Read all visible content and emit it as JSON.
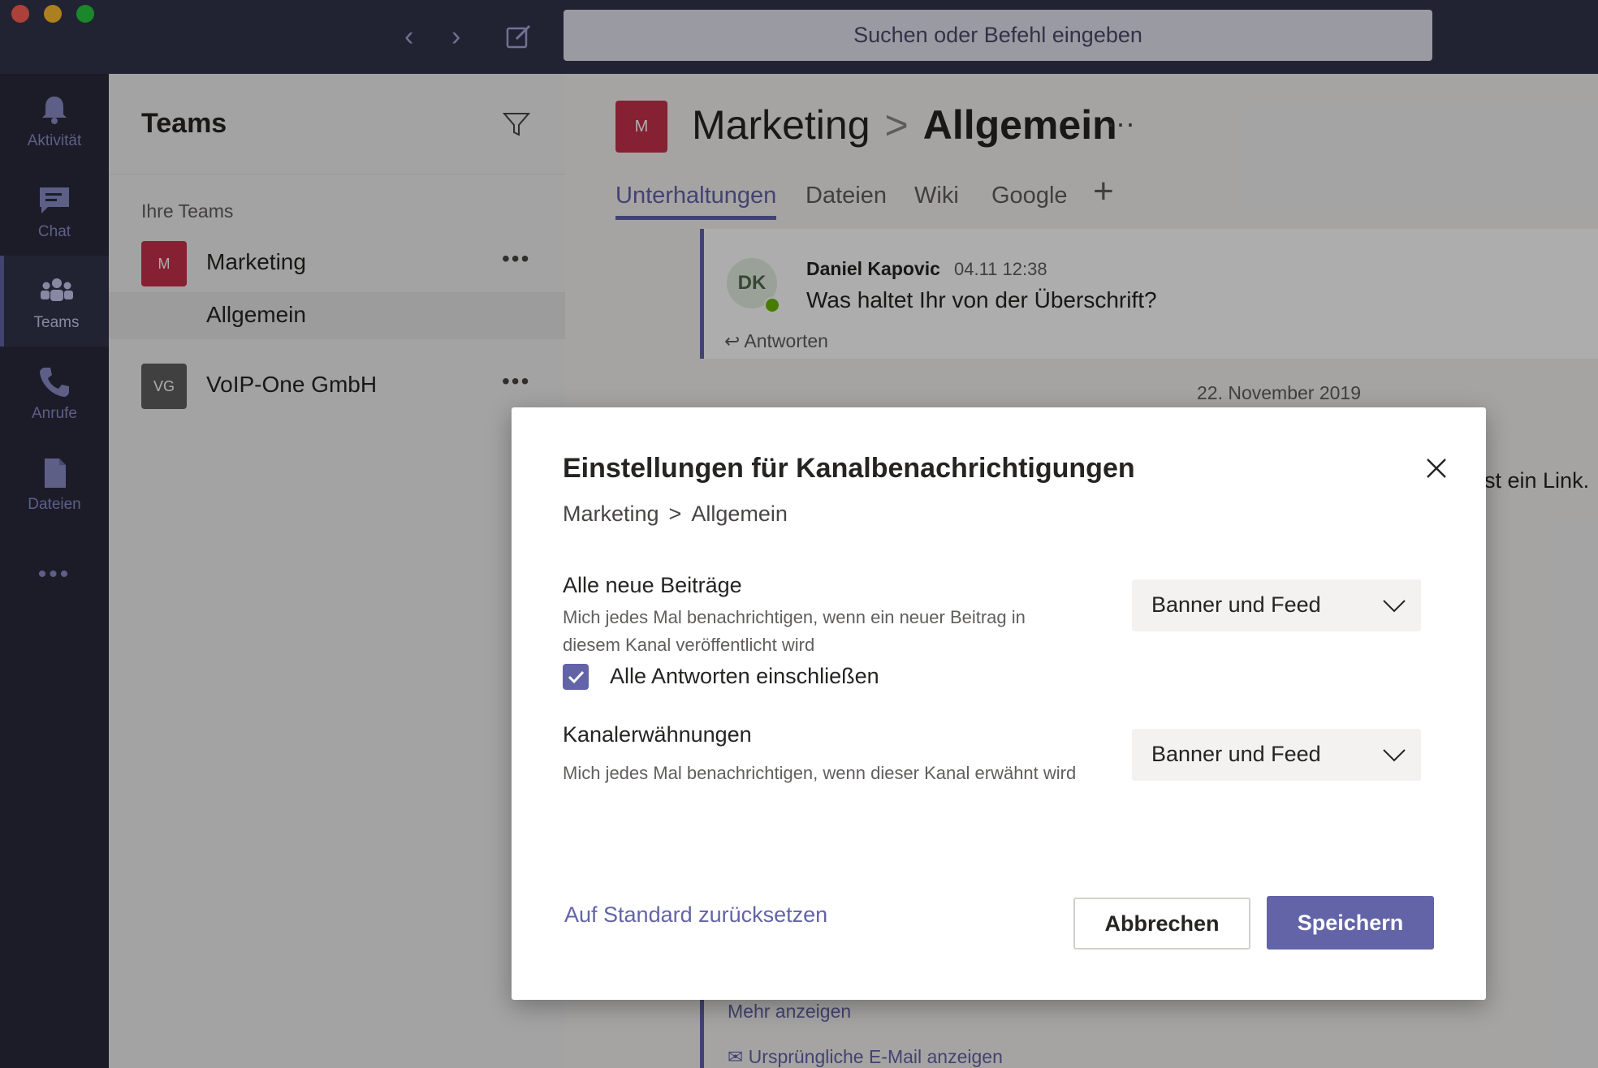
{
  "search": {
    "placeholder": "Suchen oder Befehl eingeben"
  },
  "rail": {
    "items": [
      {
        "label": "Aktivität",
        "icon": "bell-icon"
      },
      {
        "label": "Chat",
        "icon": "chat-icon"
      },
      {
        "label": "Teams",
        "icon": "teams-icon",
        "active": true
      },
      {
        "label": "Anrufe",
        "icon": "phone-icon"
      },
      {
        "label": "Dateien",
        "icon": "file-icon"
      }
    ],
    "more": "•••"
  },
  "teams_panel": {
    "title": "Teams",
    "section_label": "Ihre Teams",
    "teams": [
      {
        "initials": "M",
        "name": "Marketing",
        "more": "•••",
        "color": "#c4314b"
      },
      {
        "initials": "VG",
        "name": "VoIP-One GmbH",
        "more": "•••",
        "color": "#5f5f5f"
      }
    ],
    "selected_channel": "Allgemein"
  },
  "channel": {
    "avatar_initials": "M",
    "team": "Marketing",
    "separator": ">",
    "name": "Allgemein",
    "more": "···",
    "tabs": [
      "Unterhaltungen",
      "Dateien",
      "Wiki",
      "Google"
    ],
    "add_tab": "+"
  },
  "message": {
    "avatar_initials": "DK",
    "author": "Daniel Kapovic",
    "time": "04.11 12:38",
    "text": "Was haltet Ihr von der Überschrift?",
    "reply_label": "Antworten"
  },
  "feed": {
    "date_separator": "22. November 2019",
    "partial_text": "st ein Link.",
    "more_label": "Mehr anzeigen",
    "original_email_label": "Ursprüngliche E-Mail anzeigen"
  },
  "dialog": {
    "title": "Einstellungen für Kanalbenachrichtigungen",
    "crumb_team": "Marketing",
    "crumb_sep": ">",
    "crumb_channel": "Allgemein",
    "option1": {
      "title": "Alle neue Beiträge",
      "description": "Mich jedes Mal benachrichtigen, wenn ein neuer Beitrag in diesem Kanal veröffentlicht wird",
      "value": "Banner und Feed"
    },
    "checkbox": {
      "label": "Alle Antworten einschließen",
      "checked": true
    },
    "option2": {
      "title": "Kanalerwähnungen",
      "description": "Mich jedes Mal benachrichtigen, wenn dieser Kanal erwähnt wird",
      "value": "Banner und Feed"
    },
    "reset_label": "Auf Standard zurücksetzen",
    "cancel_label": "Abbrechen",
    "save_label": "Speichern"
  },
  "colors": {
    "accent": "#6264a7",
    "titlebar": "#33344a",
    "rail": "#292a3c"
  }
}
